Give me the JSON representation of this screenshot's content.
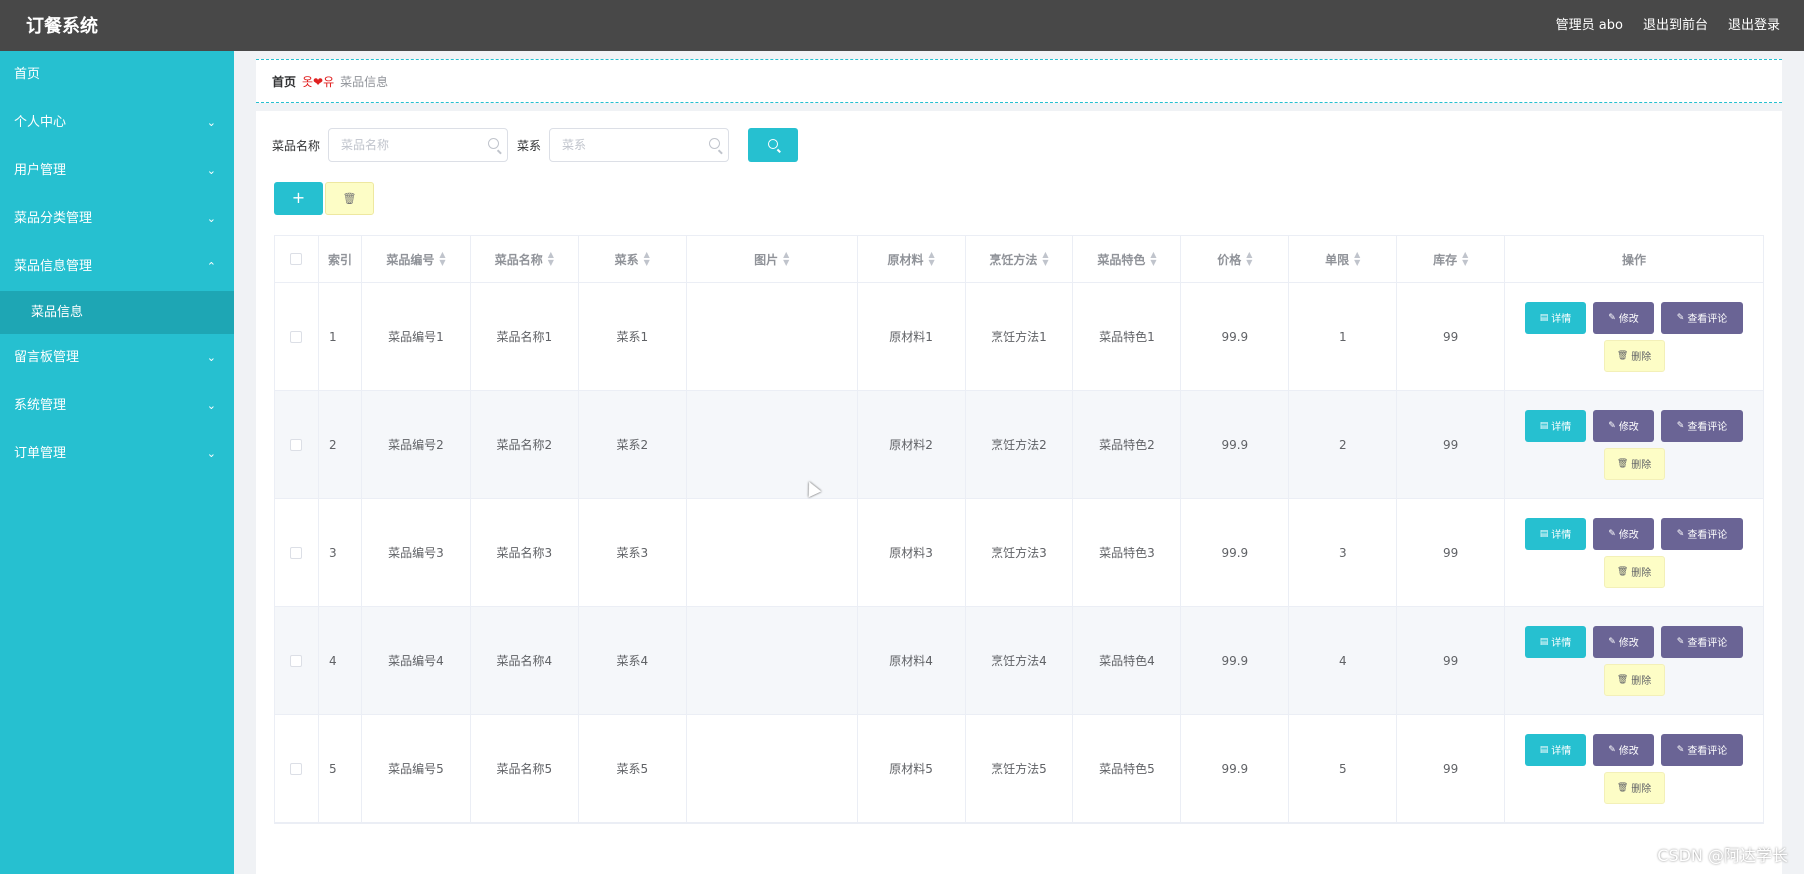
{
  "header": {
    "title": "订餐系统",
    "admin_label": "管理员 abo",
    "front_label": "退出到前台",
    "logout_label": "退出登录"
  },
  "sidebar": {
    "items": [
      {
        "label": "首页"
      },
      {
        "label": "个人中心"
      },
      {
        "label": "用户管理"
      },
      {
        "label": "菜品分类管理"
      },
      {
        "label": "菜品信息管理"
      },
      {
        "label": "菜品信息"
      },
      {
        "label": "留言板管理"
      },
      {
        "label": "系统管理"
      },
      {
        "label": "订单管理"
      }
    ]
  },
  "breadcrumb": {
    "home": "首页",
    "separator": "옷❤유",
    "current": "菜品信息"
  },
  "search": {
    "name_label": "菜品名称",
    "name_placeholder": "菜品名称",
    "cuisine_label": "菜系",
    "cuisine_placeholder": "菜系"
  },
  "table": {
    "headers": {
      "index": "索引",
      "code": "菜品编号",
      "name": "菜品名称",
      "cuisine": "菜系",
      "image": "图片",
      "material": "原材料",
      "method": "烹饪方法",
      "feature": "菜品特色",
      "price": "价格",
      "limit": "单限",
      "stock": "库存",
      "ops": "操作"
    },
    "rows": [
      {
        "index": "1",
        "code": "菜品编号1",
        "name": "菜品名称1",
        "cuisine": "菜系1",
        "material": "原材料1",
        "method": "烹饪方法1",
        "feature": "菜品特色1",
        "price": "99.9",
        "limit": "1",
        "stock": "99"
      },
      {
        "index": "2",
        "code": "菜品编号2",
        "name": "菜品名称2",
        "cuisine": "菜系2",
        "material": "原材料2",
        "method": "烹饪方法2",
        "feature": "菜品特色2",
        "price": "99.9",
        "limit": "2",
        "stock": "99"
      },
      {
        "index": "3",
        "code": "菜品编号3",
        "name": "菜品名称3",
        "cuisine": "菜系3",
        "material": "原材料3",
        "method": "烹饪方法3",
        "feature": "菜品特色3",
        "price": "99.9",
        "limit": "3",
        "stock": "99"
      },
      {
        "index": "4",
        "code": "菜品编号4",
        "name": "菜品名称4",
        "cuisine": "菜系4",
        "material": "原材料4",
        "method": "烹饪方法4",
        "feature": "菜品特色4",
        "price": "99.9",
        "limit": "4",
        "stock": "99"
      },
      {
        "index": "5",
        "code": "菜品编号5",
        "name": "菜品名称5",
        "cuisine": "菜系5",
        "material": "原材料5",
        "method": "烹饪方法5",
        "feature": "菜品特色5",
        "price": "99.9",
        "limit": "5",
        "stock": "99"
      }
    ],
    "actions": {
      "detail": "详情",
      "edit": "修改",
      "comments": "查看评论",
      "delete": "删除"
    }
  },
  "watermark": "CSDN @阿达学长"
}
